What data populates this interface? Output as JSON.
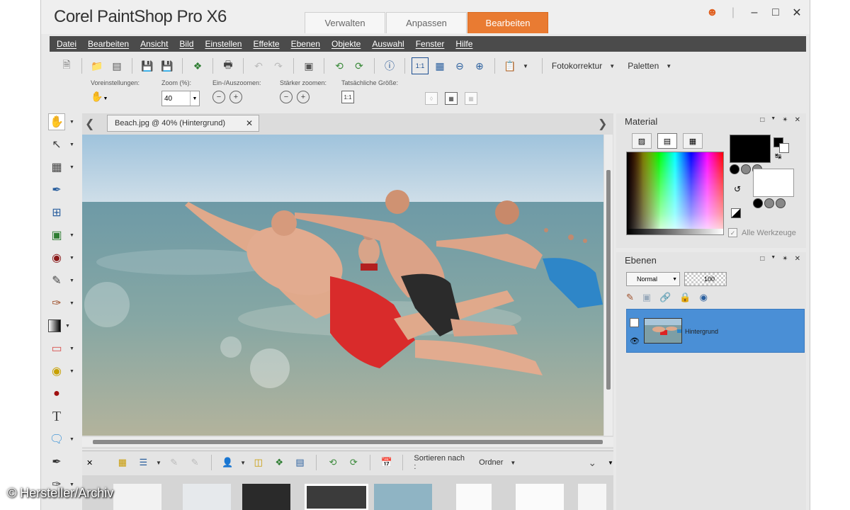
{
  "app": {
    "title": "Corel PaintShop Pro X6",
    "workspace_tabs": [
      {
        "label": "Verwalten",
        "active": false
      },
      {
        "label": "Anpassen",
        "active": false
      },
      {
        "label": "Bearbeiten",
        "active": true
      }
    ],
    "window_controls": [
      "user-icon",
      "minimize-icon",
      "maximize-icon",
      "close-icon"
    ]
  },
  "menu": [
    "Datei",
    "Bearbeiten",
    "Ansicht",
    "Bild",
    "Einstellen",
    "Effekte",
    "Ebenen",
    "Objekte",
    "Auswahl",
    "Fenster",
    "Hilfe"
  ],
  "toolbar": {
    "fotokorrektur": "Fotokorrektur",
    "paletten": "Paletten"
  },
  "options": {
    "voreinstellungen_label": "Voreinstellungen:",
    "zoom_label": "Zoom (%):",
    "zoom_value": "40",
    "einaus_label": "Ein-/Auszoomen:",
    "staerker_label": "Stärker zoomen:",
    "tatsaechlich_label": "Tatsächliche Größe:",
    "actual_size_icon": "1:1"
  },
  "document": {
    "tab_label": "Beach.jpg @  40% (Hintergrund)"
  },
  "organizer": {
    "sort_label": "Sortieren nach :",
    "sort_value": "Ordner"
  },
  "material": {
    "title": "Material",
    "all_tools_label": "Alle Werkzeuge"
  },
  "layers": {
    "title": "Ebenen",
    "blend_mode": "Normal",
    "opacity": "100",
    "items": [
      {
        "name": "Hintergrund",
        "selected": true
      }
    ]
  },
  "watermark": "© Hersteller/Archiv",
  "colors": {
    "accent": "#e97b32",
    "menubar": "#4b4b4b",
    "layer_selected": "#4a8fd6"
  }
}
